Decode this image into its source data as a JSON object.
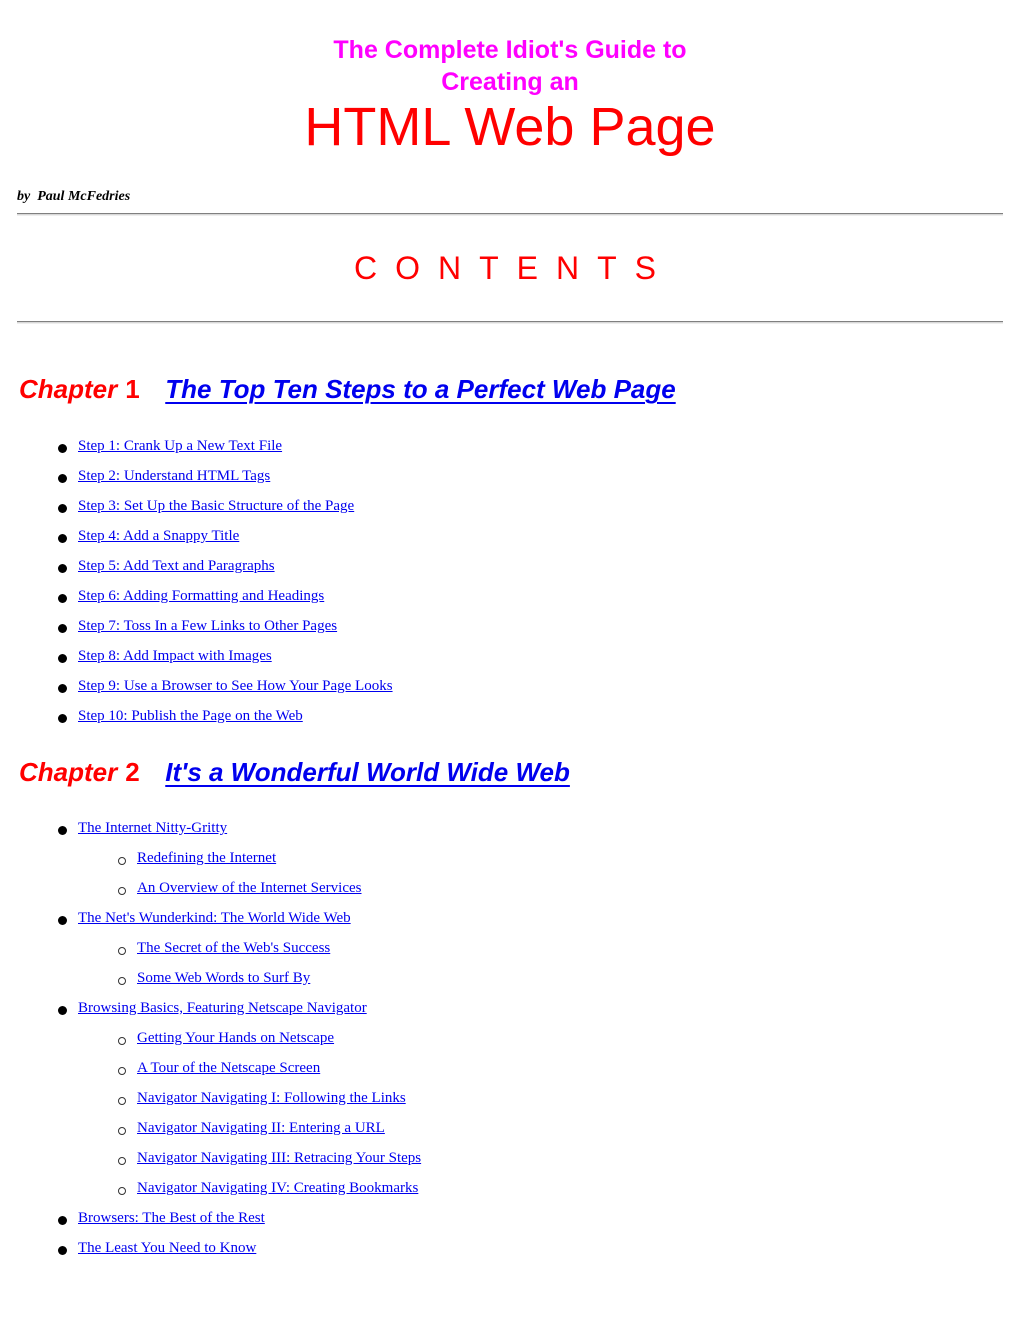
{
  "header": {
    "title_line1": "The Complete Idiot's Guide to",
    "title_line2": "Creating an",
    "title_line3": "HTML Web Page",
    "byline": "by  Paul McFedries"
  },
  "contents_heading": "CONTENTS",
  "colors": {
    "title_magenta": "#ff00ff",
    "title_red": "#ff0000",
    "link_blue": "#0000ee",
    "text_black": "#000000"
  },
  "chapters": [
    {
      "label": "Chapter",
      "number": "1",
      "title": "The Top Ten Steps to a Perfect Web Page",
      "items": [
        {
          "level": 1,
          "bullet_icon": "filled-disc",
          "text": "Step 1: Crank Up a New Text File"
        },
        {
          "level": 1,
          "bullet_icon": "filled-disc",
          "text": "Step 2: Understand HTML Tags"
        },
        {
          "level": 1,
          "bullet_icon": "filled-disc",
          "text": "Step 3: Set Up the Basic Structure of the Page"
        },
        {
          "level": 1,
          "bullet_icon": "filled-disc",
          "text": "Step 4: Add a Snappy Title"
        },
        {
          "level": 1,
          "bullet_icon": "filled-disc",
          "text": "Step 5: Add Text and Paragraphs"
        },
        {
          "level": 1,
          "bullet_icon": "filled-disc",
          "text": "Step 6: Adding Formatting and Headings"
        },
        {
          "level": 1,
          "bullet_icon": "filled-disc",
          "text": "Step 7: Toss In a Few Links to Other Pages"
        },
        {
          "level": 1,
          "bullet_icon": "filled-disc",
          "text": "Step 8: Add Impact with Images"
        },
        {
          "level": 1,
          "bullet_icon": "filled-disc",
          "text": "Step 9: Use a Browser to See How Your Page Looks"
        },
        {
          "level": 1,
          "bullet_icon": "filled-disc",
          "text": "Step 10: Publish the Page on the Web"
        }
      ]
    },
    {
      "label": "Chapter",
      "number": "2",
      "title": "It's a Wonderful World Wide Web",
      "items": [
        {
          "level": 1,
          "bullet_icon": "filled-disc",
          "text": "The Internet Nitty-Gritty"
        },
        {
          "level": 2,
          "bullet_icon": "hollow-circle",
          "text": "Redefining the Internet"
        },
        {
          "level": 2,
          "bullet_icon": "hollow-circle",
          "text": "An Overview of the Internet Services"
        },
        {
          "level": 1,
          "bullet_icon": "filled-disc",
          "text": "The Net's Wunderkind: The World Wide Web"
        },
        {
          "level": 2,
          "bullet_icon": "hollow-circle",
          "text": "The Secret of the Web's Success"
        },
        {
          "level": 2,
          "bullet_icon": "hollow-circle",
          "text": "Some Web Words to Surf By"
        },
        {
          "level": 1,
          "bullet_icon": "filled-disc",
          "text": "Browsing Basics, Featuring Netscape Navigator"
        },
        {
          "level": 2,
          "bullet_icon": "hollow-circle",
          "text": "Getting Your Hands on Netscape"
        },
        {
          "level": 2,
          "bullet_icon": "hollow-circle",
          "text": "A Tour of the Netscape Screen"
        },
        {
          "level": 2,
          "bullet_icon": "hollow-circle",
          "text": "Navigator Navigating I: Following the Links"
        },
        {
          "level": 2,
          "bullet_icon": "hollow-circle",
          "text": "Navigator Navigating II: Entering a URL"
        },
        {
          "level": 2,
          "bullet_icon": "hollow-circle",
          "text": "Navigator Navigating III: Retracing Your Steps"
        },
        {
          "level": 2,
          "bullet_icon": "hollow-circle",
          "text": "Navigator Navigating IV: Creating Bookmarks"
        },
        {
          "level": 1,
          "bullet_icon": "filled-disc",
          "text": "Browsers: The Best of the Rest"
        },
        {
          "level": 1,
          "bullet_icon": "filled-disc",
          "text": "The Least You Need to Know"
        }
      ]
    }
  ]
}
